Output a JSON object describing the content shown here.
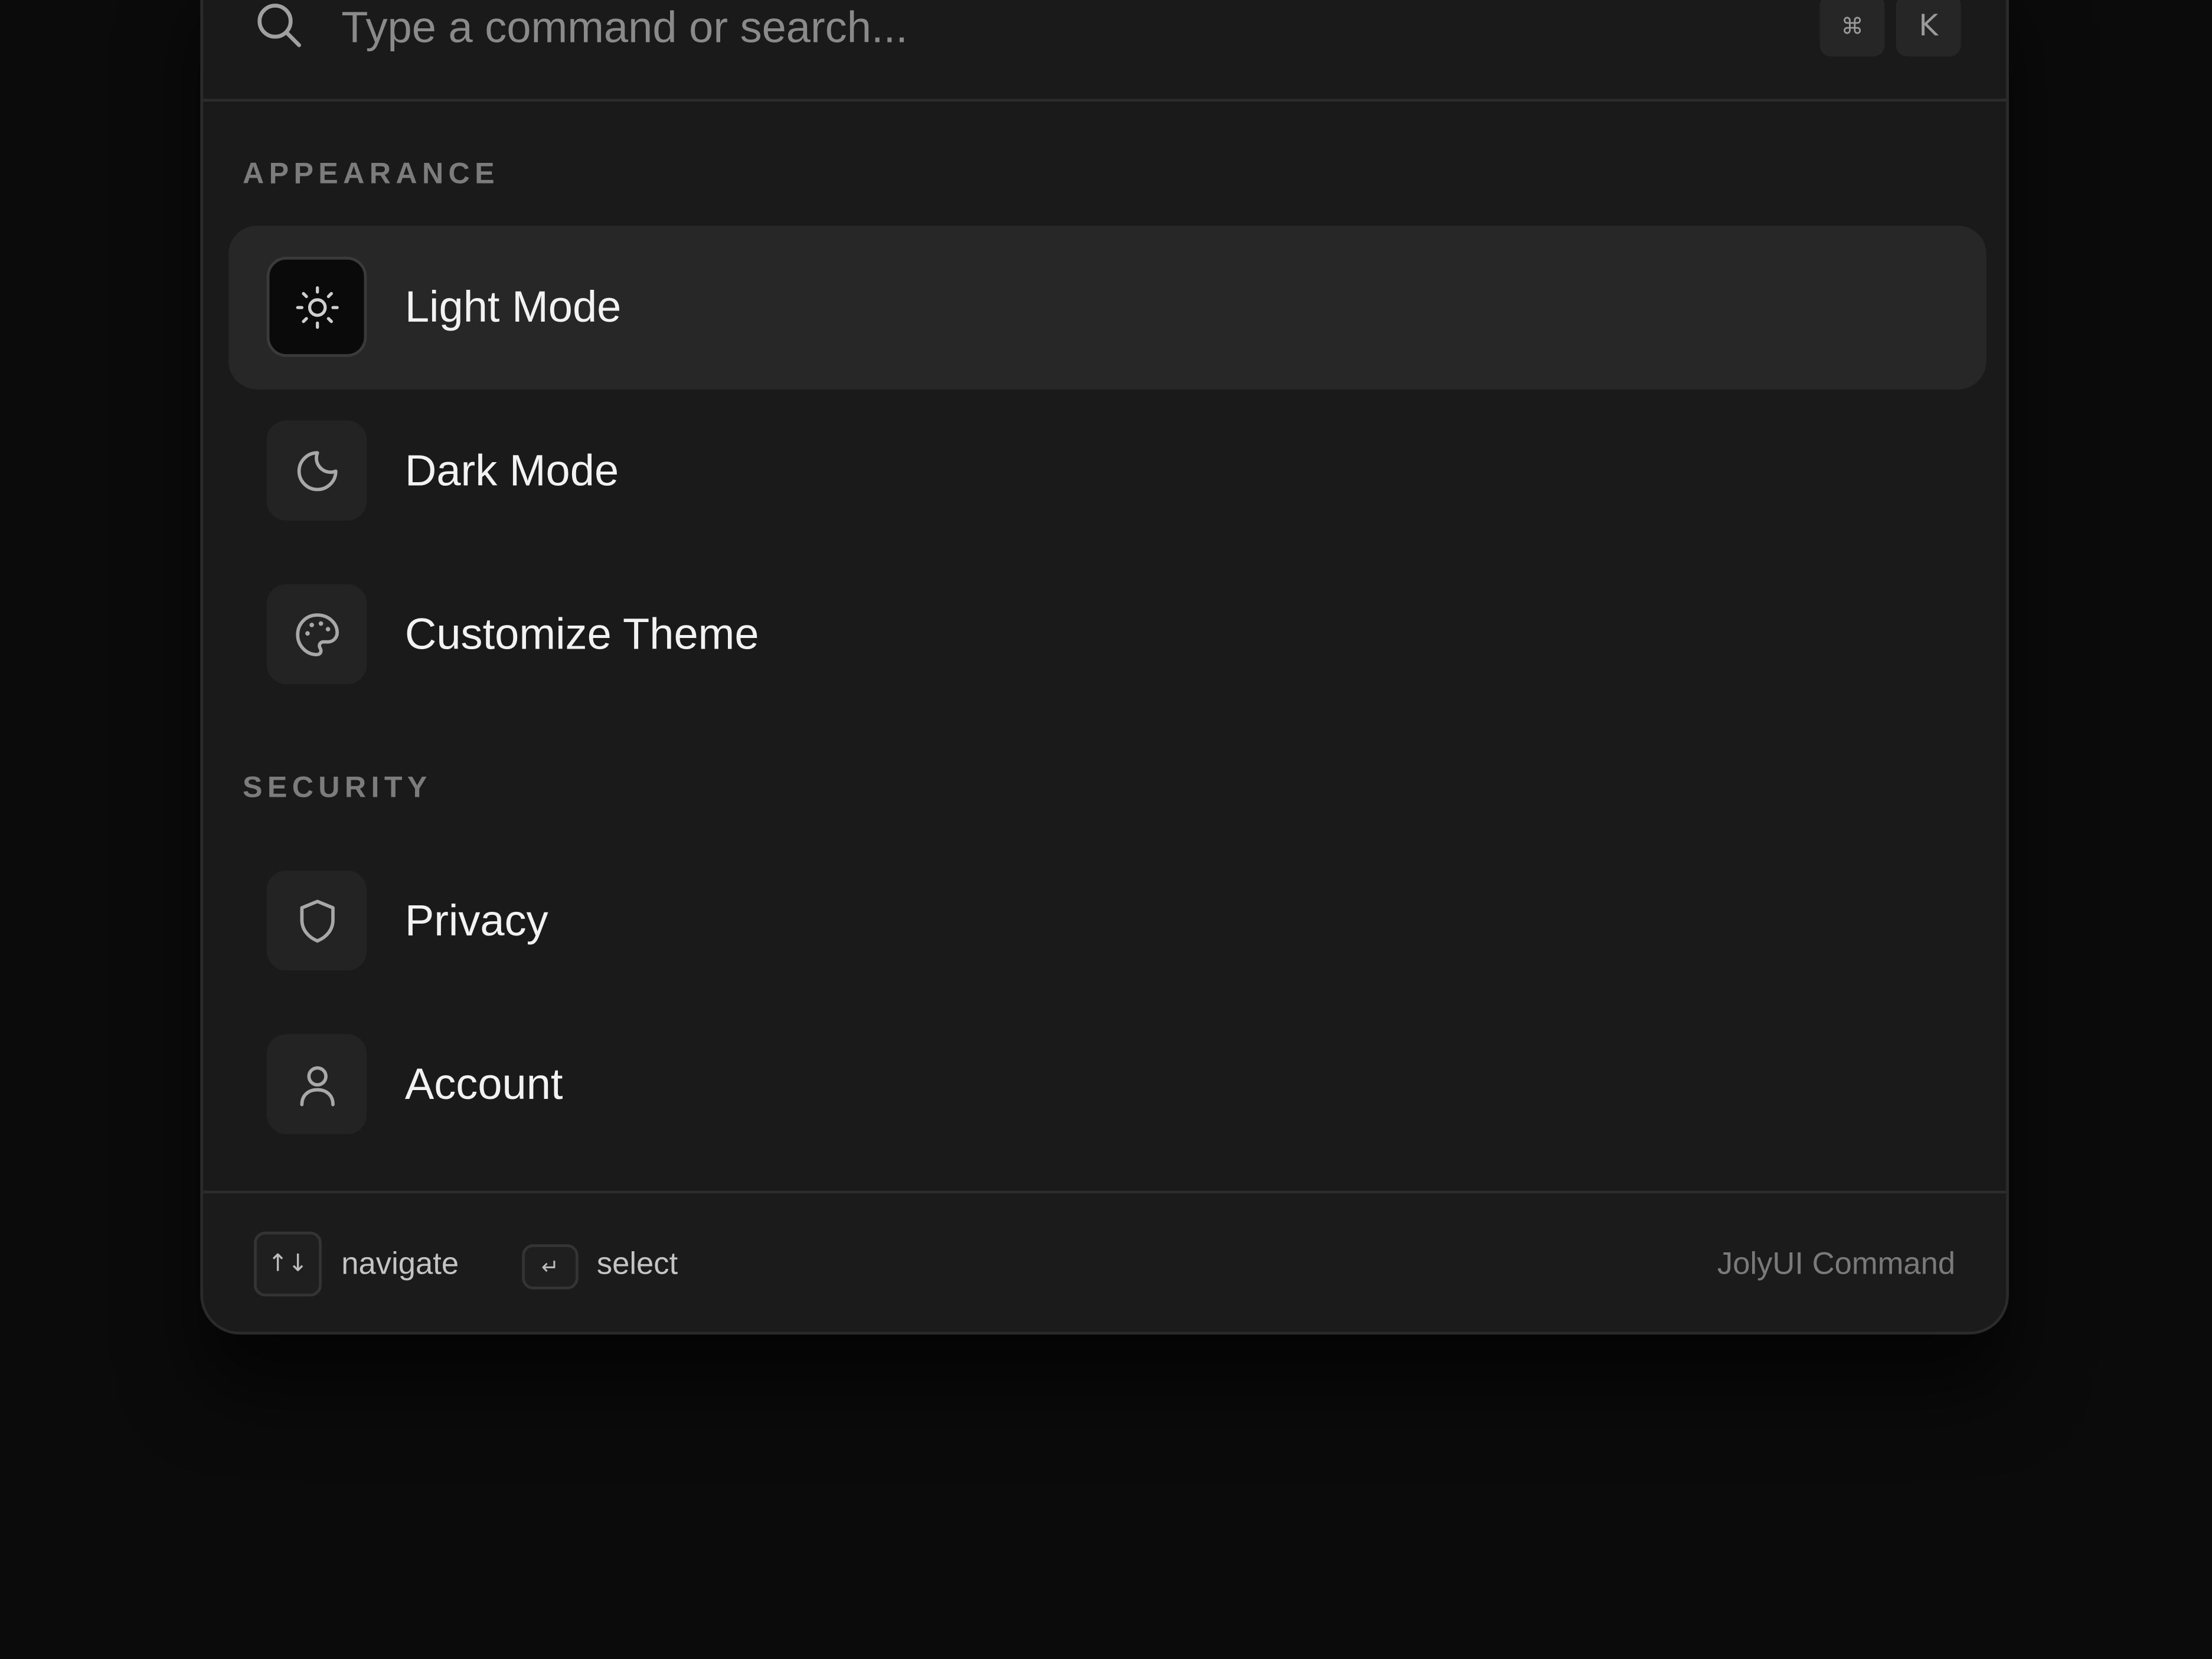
{
  "search": {
    "placeholder": "Type a command or search...",
    "shortcut": [
      "⌘",
      "K"
    ]
  },
  "groups": [
    {
      "heading": "APPEARANCE",
      "items": [
        {
          "label": "Light Mode",
          "icon": "sun-icon",
          "active": true
        },
        {
          "label": "Dark Mode",
          "icon": "moon-icon",
          "active": false
        },
        {
          "label": "Customize Theme",
          "icon": "palette-icon",
          "active": false
        }
      ]
    },
    {
      "heading": "SECURITY",
      "items": [
        {
          "label": "Privacy",
          "icon": "shield-icon",
          "active": false
        },
        {
          "label": "Account",
          "icon": "user-icon",
          "active": false
        }
      ]
    }
  ],
  "footer": {
    "navigate_keys": "↑↓",
    "navigate_label": "navigate",
    "select_key": "↵",
    "select_label": "select",
    "brand": "JolyUI Command"
  },
  "colors": {
    "background": "#0b0b0b",
    "panel": "#1a1a1a",
    "active_item": "#272727",
    "text": "#f2f2f2",
    "muted": "#7c7c7c"
  }
}
